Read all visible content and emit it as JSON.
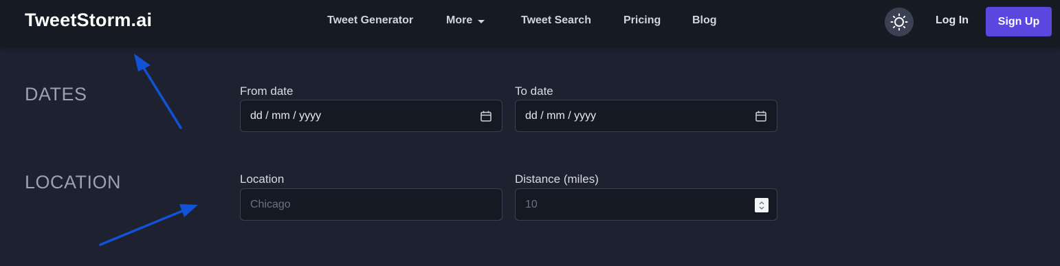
{
  "navbar": {
    "logo": "TweetStorm.ai",
    "links": {
      "tweet_generator": "Tweet Generator",
      "more": "More",
      "tweet_search": "Tweet Search",
      "pricing": "Pricing",
      "blog": "Blog"
    },
    "login": "Log In",
    "signup": "Sign Up"
  },
  "dates": {
    "title": "DATES",
    "from_label": "From date",
    "from_value": "dd / mm / yyyy",
    "to_label": "To date",
    "to_value": "dd / mm / yyyy"
  },
  "location": {
    "title": "LOCATION",
    "location_label": "Location",
    "location_placeholder": "Chicago",
    "distance_label": "Distance (miles)",
    "distance_placeholder": "10"
  },
  "colors": {
    "background": "#1e2130",
    "navbar": "#161a23",
    "accent": "#5b46e0",
    "annotation_arrow": "#1252d6"
  }
}
